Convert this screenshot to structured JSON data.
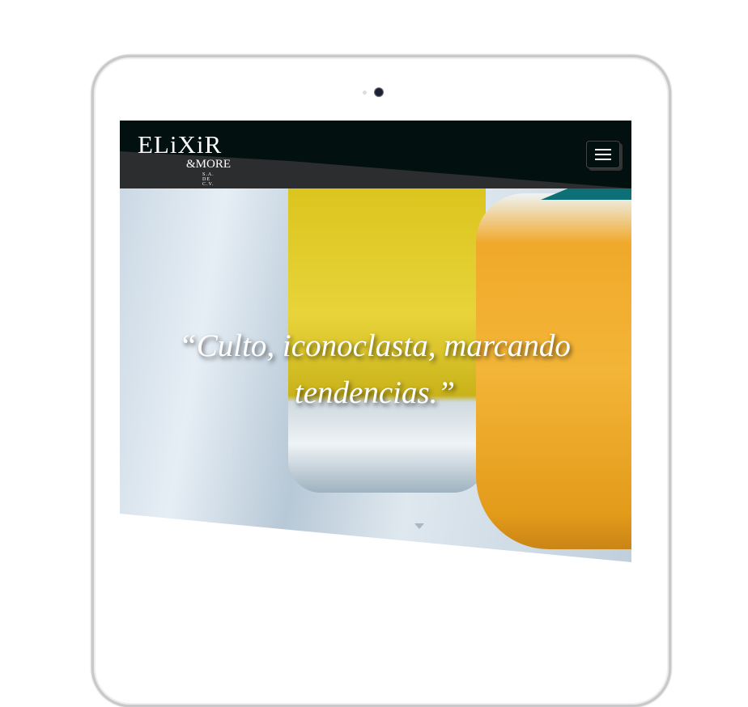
{
  "header": {
    "logo": {
      "main": "ELiXiR",
      "sub": "&MORE",
      "small": "S.A. DE C.V."
    },
    "menu_icon": "hamburger-icon"
  },
  "hero": {
    "quote": "“Culto, iconoclasta, marcando tendencias.”"
  },
  "colors": {
    "header": "#02100f",
    "accent_teal": "#0d7077"
  }
}
